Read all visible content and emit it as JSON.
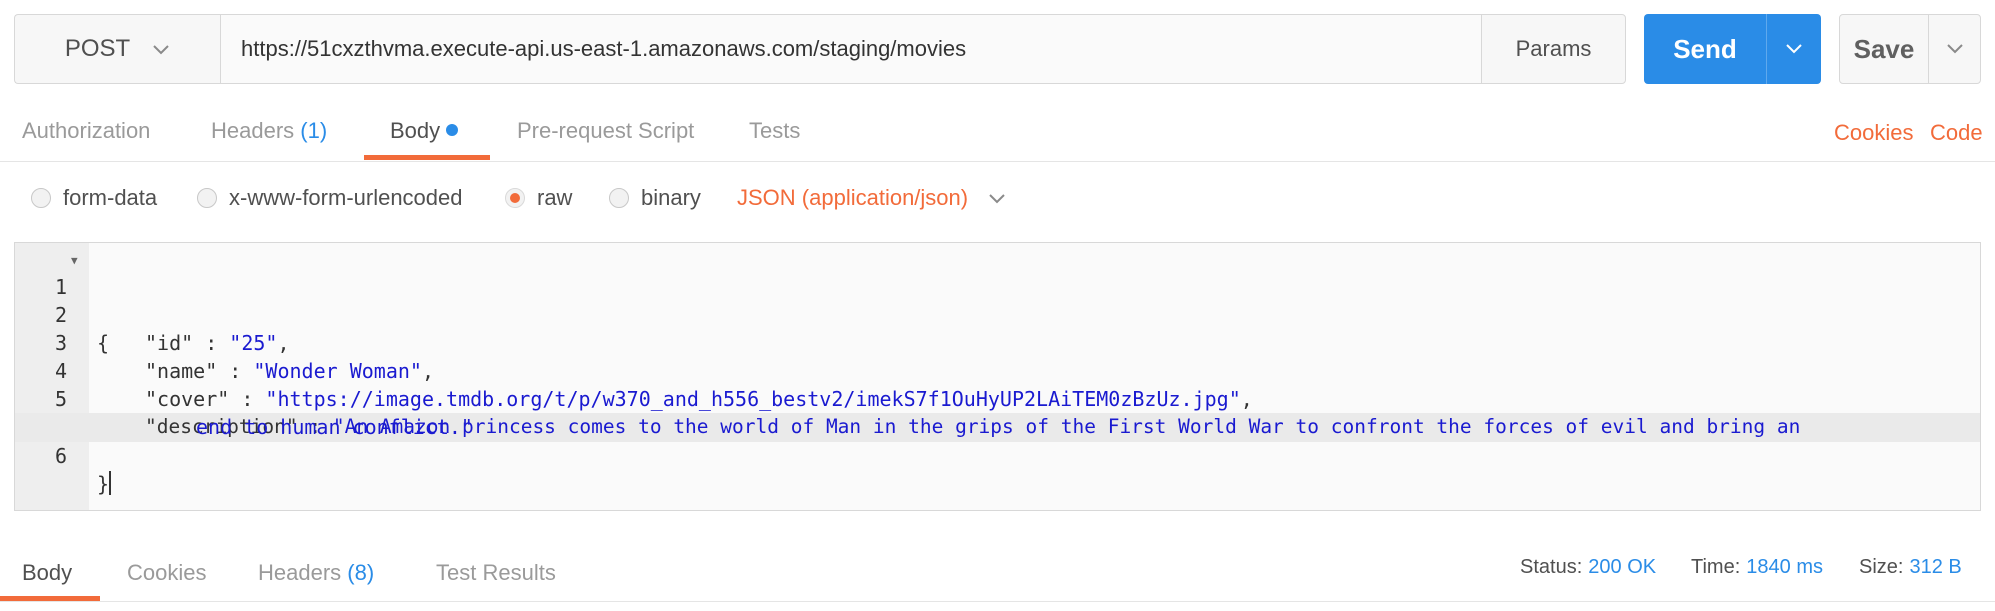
{
  "request": {
    "method": "POST",
    "url": "https://51cxzthvma.execute-api.us-east-1.amazonaws.com/staging/movies",
    "params_label": "Params",
    "send_label": "Send",
    "save_label": "Save"
  },
  "request_tabs": {
    "authorization": "Authorization",
    "headers": "Headers",
    "headers_count": "(1)",
    "body": "Body",
    "prerequest": "Pre-request Script",
    "tests": "Tests",
    "cookies": "Cookies",
    "code": "Code"
  },
  "body_types": {
    "form_data": "form-data",
    "urlencoded": "x-www-form-urlencoded",
    "raw": "raw",
    "binary": "binary",
    "selected": "raw",
    "content_type": "JSON (application/json)"
  },
  "editor": {
    "line_numbers": [
      "1",
      "2",
      "3",
      "4",
      "5",
      "6"
    ],
    "lines": [
      "{",
      "\"id\" : \"25\",",
      "\"name\" : \"Wonder Woman\",",
      "\"cover\" : \"https://image.tmdb.org/t/p/w370_and_h556_bestv2/imekS7f1OuHyUP2LAiTEM0zBzUz.jpg\",",
      "\"description\" : \"An Amazon princess comes to the world of Man in the grips of the First World War to confront the forces of evil and bring an",
      "end to human conflict.\"",
      "}"
    ],
    "tokens": {
      "id_key": "\"id\"",
      "id_val": "\"25\"",
      "name_key": "\"name\"",
      "name_val": "\"Wonder Woman\"",
      "cover_key": "\"cover\"",
      "cover_val": "\"https://image.tmdb.org/t/p/w370_and_h556_bestv2/imekS7f1OuHyUP2LAiTEM0zBzUz.jpg\"",
      "desc_key": "\"description\"",
      "desc_val_1": "\"An Amazon princess comes to the world of Man in the grips of the First World War to confront the forces of evil and bring an",
      "desc_val_2": "end to human conflict.\"",
      "open_brace": "{",
      "close_brace": "}",
      "sep": " : ",
      "comma": ","
    }
  },
  "response": {
    "tabs": {
      "body": "Body",
      "cookies": "Cookies",
      "headers": "Headers",
      "headers_count": "(8)",
      "test_results": "Test Results"
    },
    "status_label": "Status:",
    "status_value": "200 OK",
    "time_label": "Time:",
    "time_value": "1840 ms",
    "size_label": "Size:",
    "size_value": "312 B"
  },
  "colors": {
    "accent_orange": "#f26b3a",
    "accent_blue": "#2a8ce7",
    "string_blue": "#1a1ad0"
  }
}
